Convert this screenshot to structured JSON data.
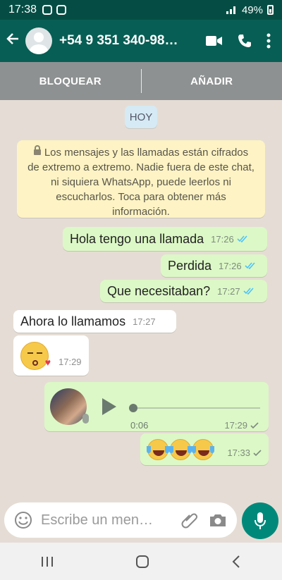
{
  "status_bar": {
    "time": "17:38",
    "battery": "49%"
  },
  "header": {
    "contact_name": "+54 9 351 340-98…"
  },
  "actions": {
    "block": "BLOQUEAR",
    "add": "AÑADIR"
  },
  "chat": {
    "date_label": "HOY",
    "encryption_notice": "Los mensajes y las llamadas están cifrados de extremo a extremo. Nadie fuera de este chat, ni siquiera WhatsApp, puede leerlos ni escucharlos. Toca para obtener más información.",
    "messages": [
      {
        "text": "Hola tengo una llamada",
        "time": "17:26"
      },
      {
        "text": "Perdida",
        "time": "17:26"
      },
      {
        "text": "Que necesitaban?",
        "time": "17:27"
      },
      {
        "text": "Ahora lo llamamos",
        "time": "17:27"
      },
      {
        "text": "",
        "time": "17:29"
      },
      {
        "text": "",
        "time": "17:29",
        "duration": "0:06"
      },
      {
        "text": "",
        "time": "17:33"
      }
    ]
  },
  "composer": {
    "placeholder": "Escribe un men…"
  },
  "colors": {
    "header": "#075e54",
    "status_bar": "#054d44",
    "outgoing_bubble": "#dcf8c6",
    "incoming_bubble": "#ffffff",
    "chat_background": "#e5ddd5",
    "read_ticks": "#4fc3f7",
    "mic_button": "#00897b"
  },
  "icons": [
    "back-arrow-icon",
    "video-call-icon",
    "phone-call-icon",
    "more-options-icon",
    "lock-icon",
    "double-check-icon",
    "single-check-icon",
    "play-icon",
    "emoji-icon",
    "attach-icon",
    "camera-icon",
    "mic-icon",
    "recents-icon",
    "home-icon",
    "back-nav-icon"
  ]
}
